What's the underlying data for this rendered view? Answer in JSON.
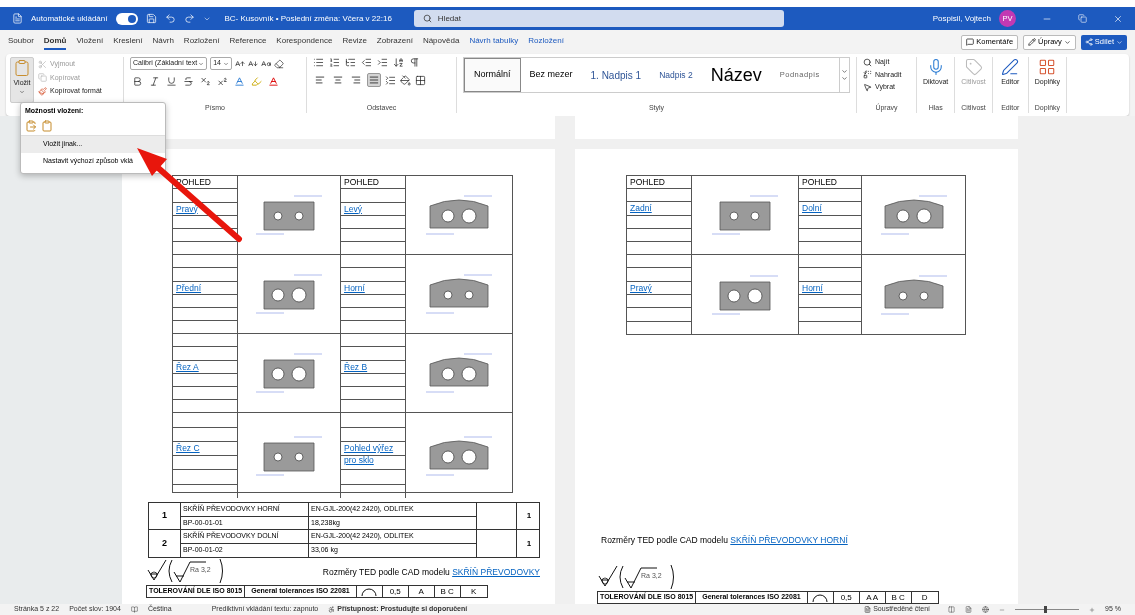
{
  "titlebar": {
    "autosave_label": "Automatické ukládání",
    "autosave_on": true,
    "title": "BC- Kusovník • Poslední změna: Včera v 22:16",
    "search_placeholder": "Hledat",
    "user": "Pospisil, Vojtech",
    "avatar": "PV"
  },
  "menu_tabs": [
    {
      "label": "Soubor",
      "selected": false,
      "kind": "normal"
    },
    {
      "label": "Domů",
      "selected": true,
      "kind": "normal"
    },
    {
      "label": "Vložení",
      "selected": false,
      "kind": "normal"
    },
    {
      "label": "Kreslení",
      "selected": false,
      "kind": "normal"
    },
    {
      "label": "Návrh",
      "selected": false,
      "kind": "normal"
    },
    {
      "label": "Rozložení",
      "selected": false,
      "kind": "normal"
    },
    {
      "label": "Reference",
      "selected": false,
      "kind": "normal"
    },
    {
      "label": "Korespondence",
      "selected": false,
      "kind": "normal"
    },
    {
      "label": "Revize",
      "selected": false,
      "kind": "normal"
    },
    {
      "label": "Zobrazení",
      "selected": false,
      "kind": "normal"
    },
    {
      "label": "Nápověda",
      "selected": false,
      "kind": "normal"
    },
    {
      "label": "Návrh tabulky",
      "selected": false,
      "kind": "contextual"
    },
    {
      "label": "Rozložení",
      "selected": false,
      "kind": "contextual"
    }
  ],
  "top_buttons": {
    "comments": "Komentáře",
    "editing": "Úpravy",
    "share": "Sdílet"
  },
  "clipboard": {
    "paste": "Vložit",
    "cut": {
      "label": "Vyjmout",
      "disabled": true
    },
    "copy": {
      "label": "Kopírovat",
      "disabled": true
    },
    "format_painter": {
      "label": "Kopírovat formát",
      "disabled": false
    }
  },
  "font": {
    "name": "Calibri (Základní text",
    "size": "14",
    "label": "Písmo"
  },
  "paragraph": {
    "label": "Odstavec",
    "alignment": [
      {
        "kind": "left",
        "selected": false
      },
      {
        "kind": "center",
        "selected": false
      },
      {
        "kind": "right",
        "selected": false
      },
      {
        "kind": "justify",
        "selected": true
      }
    ]
  },
  "styles": {
    "label": "Styly",
    "items": [
      {
        "label": "Normální",
        "kind": "normal",
        "selected": true
      },
      {
        "label": "Bez mezer",
        "kind": "nospace",
        "selected": false
      },
      {
        "label": "1.  Nadpis 1",
        "kind": "heading1",
        "selected": false
      },
      {
        "label": "Nadpis 2",
        "kind": "heading2",
        "selected": false
      },
      {
        "label": "Název",
        "kind": "title",
        "selected": false
      },
      {
        "label": "Podnadpis",
        "kind": "subtitle",
        "selected": false
      }
    ]
  },
  "editing": {
    "label": "Úpravy",
    "find": "Najít",
    "replace": "Nahradit",
    "select": "Vybrat"
  },
  "big_groups": [
    {
      "kind": "mic",
      "button": "Diktovat",
      "label": "Hlas",
      "disabled": false
    },
    {
      "kind": "sensitivity",
      "button": "Citlivost",
      "label": "Citlivost",
      "disabled": true
    },
    {
      "kind": "editor",
      "button": "Editor",
      "label": "Editor",
      "disabled": false
    },
    {
      "kind": "addins",
      "button": "Doplňky",
      "label": "Doplňky",
      "disabled": false
    }
  ],
  "paste_menu": {
    "title": "Možnosti vložení:",
    "items": [
      {
        "label": "Vložit jinak...",
        "selected": true
      },
      {
        "label": "Nastavit výchozí způsob vklá",
        "selected": false
      }
    ]
  },
  "pages": [
    {
      "headers": [
        "POHLED",
        "POHLED"
      ],
      "blocks": [
        [
          "Pravý",
          "Levý"
        ],
        [
          "Přední",
          "Horní"
        ],
        [
          "Řez A",
          "Řez B"
        ],
        [
          "Řez C",
          "Pohled výřez pro sklo"
        ]
      ],
      "parts": [
        {
          "number": "1",
          "name": "SKŘÍŇ PŘEVODOVKY HORNÍ",
          "code": "BP-00-01-01",
          "material": "EN-GJL-200(42 2420), ODLITEK",
          "mass": "18,238kg",
          "quantity": "1"
        },
        {
          "number": "2",
          "name": "SKŘÍŇ PŘEVODOVKY DOLNÍ",
          "code": "BP-00-01-02",
          "material": "EN-GJL-200(42 2420), ODLITEK",
          "mass": "33,06 kg",
          "quantity": "1"
        }
      ],
      "caption": "Rozměry TED podle CAD modelu",
      "caption_link": "SKŘÍŇ PŘEVODOVKY",
      "roughness": "Ra 3,2",
      "tolerance": [
        "TOLEROVÁNÍ DLE ISO 8015",
        "General tolerances ISO 22081",
        "0,5",
        "A",
        "B C",
        "K"
      ]
    },
    {
      "headers": [
        "POHLED",
        "POHLED"
      ],
      "blocks": [
        [
          "Zadní",
          "Dolní"
        ],
        [
          "Pravý",
          "Horní"
        ]
      ],
      "caption": "Rozměry TED podle CAD modelu",
      "caption_link": "SKŘÍŇ PŘEVODOVKY HORNÍ",
      "roughness": "Ra 3,2",
      "tolerance": [
        "TOLEROVÁNÍ DLE ISO 8015",
        "General tolerances ISO 22081",
        "0,5",
        "A A",
        "B C",
        "D"
      ]
    }
  ],
  "status": {
    "page": "Stránka 5 z 22",
    "words": "Počet slov: 1904",
    "language": "Čeština",
    "predictive": "Prediktivní vkládání textu: zapnuto",
    "accessibility": "Přístupnost: Prostudujte si doporučení",
    "focus": "Soustředěné čtení",
    "zoom": {
      "level": 0.47,
      "reading": "95 %"
    }
  }
}
